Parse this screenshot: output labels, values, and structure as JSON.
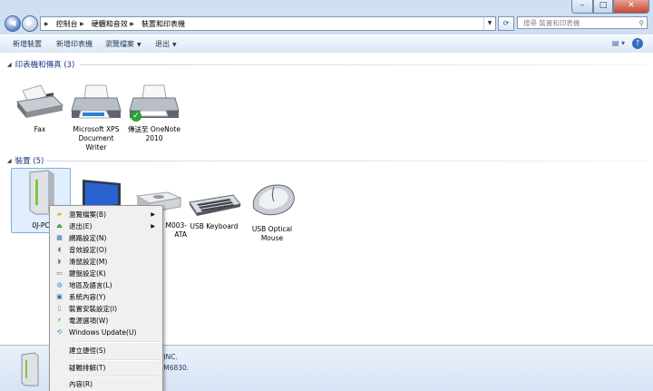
{
  "address": {
    "crumbs": [
      "控制台",
      "硬體和音效",
      "裝置和印表機"
    ]
  },
  "search": {
    "placeholder": "搜尋 裝置和印表機"
  },
  "toolbar": {
    "add_device": "新增裝置",
    "add_printer": "新增印表機",
    "browse_files": "瀏覽檔案",
    "eject": "退出"
  },
  "groups": {
    "printers": {
      "title": "印表機和傳真 (3)"
    },
    "devices": {
      "title": "裝置 (5)"
    }
  },
  "printers": [
    {
      "label": "Fax",
      "icon": "fax-icon"
    },
    {
      "label": "Microsoft XPS Document Writer",
      "icon": "printer-icon"
    },
    {
      "label": "傳送至 OneNote 2010",
      "icon": "printer-icon",
      "default": true
    }
  ],
  "devices": [
    {
      "label": "0J-PC",
      "icon": "computer-icon"
    },
    {
      "label": "",
      "icon": "monitor-icon"
    },
    {
      "label": "M003-ATA",
      "icon": "drive-icon"
    },
    {
      "label": "USB Keyboard",
      "icon": "keyboard-icon"
    },
    {
      "label": "USB Optical Mouse",
      "icon": "mouse-icon"
    }
  ],
  "details": {
    "line1": "r INC.",
    "line2": "CM6830."
  },
  "context_menu": {
    "items": [
      {
        "label": "瀏覽檔案(B)",
        "submenu": true,
        "icon": "folder-icon"
      },
      {
        "label": "退出(E)",
        "submenu": true,
        "icon": "eject-icon"
      },
      {
        "label": "網路設定(N)",
        "icon": "network-icon"
      },
      {
        "label": "音效設定(O)",
        "icon": "sound-icon"
      },
      {
        "label": "滑鼠設定(M)",
        "icon": "mouse-icon"
      },
      {
        "label": "鍵盤設定(K)",
        "icon": "keyboard-icon"
      },
      {
        "label": "地區及語言(L)",
        "icon": "globe-icon"
      },
      {
        "label": "系統內容(Y)",
        "icon": "system-icon"
      },
      {
        "label": "裝置安裝設定(I)",
        "icon": "device-icon"
      },
      {
        "label": "電源選項(W)",
        "icon": "power-icon"
      },
      {
        "label": "Windows Update(U)",
        "icon": "update-icon"
      },
      {
        "label": "建立捷徑(S)"
      },
      {
        "label": "疑難排解(T)"
      },
      {
        "label": "內容(R)"
      }
    ]
  }
}
